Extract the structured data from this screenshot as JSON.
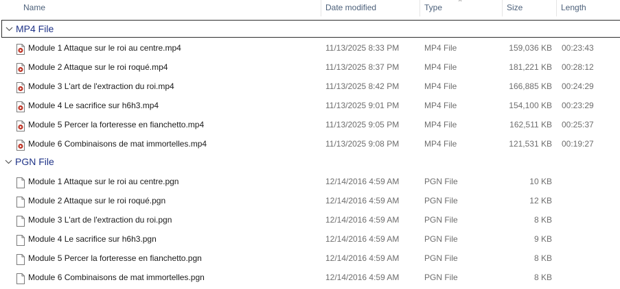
{
  "columns": {
    "name": "Name",
    "date_modified": "Date modified",
    "type": "Type",
    "size": "Size",
    "length": "Length"
  },
  "sort_indicator": "^",
  "groups": [
    {
      "label": "MP4 File",
      "icon": "video-file-icon",
      "files": [
        {
          "name": "Module 1  Attaque sur le roi au centre.mp4",
          "date": "11/13/2025 8:33 PM",
          "type": "MP4 File",
          "size": "159,036 KB",
          "length": "00:23:43"
        },
        {
          "name": "Module 2  Attaque sur le roi roqué.mp4",
          "date": "11/13/2025 8:37 PM",
          "type": "MP4 File",
          "size": "181,221 KB",
          "length": "00:28:12"
        },
        {
          "name": "Module 3  L'art de l'extraction du roi.mp4",
          "date": "11/13/2025 8:42 PM",
          "type": "MP4 File",
          "size": "166,885 KB",
          "length": "00:24:29"
        },
        {
          "name": "Module 4  Le sacrifice sur h6h3.mp4",
          "date": "11/13/2025 9:01 PM",
          "type": "MP4 File",
          "size": "154,100 KB",
          "length": "00:23:29"
        },
        {
          "name": "Module 5  Percer la forteresse en fianchetto.mp4",
          "date": "11/13/2025 9:05 PM",
          "type": "MP4 File",
          "size": "162,511 KB",
          "length": "00:25:37"
        },
        {
          "name": "Module 6  Combinaisons de mat immortelles.mp4",
          "date": "11/13/2025 9:08 PM",
          "type": "MP4 File",
          "size": "121,531 KB",
          "length": "00:19:27"
        }
      ]
    },
    {
      "label": "PGN File",
      "icon": "blank-file-icon",
      "files": [
        {
          "name": "Module 1  Attaque sur le roi au centre.pgn",
          "date": "12/14/2016 4:59 AM",
          "type": "PGN File",
          "size": "10 KB",
          "length": ""
        },
        {
          "name": "Module 2  Attaque sur le roi roqué.pgn",
          "date": "12/14/2016 4:59 AM",
          "type": "PGN File",
          "size": "12 KB",
          "length": ""
        },
        {
          "name": "Module 3  L'art de l'extraction du roi.pgn",
          "date": "12/14/2016 4:59 AM",
          "type": "PGN File",
          "size": "8 KB",
          "length": ""
        },
        {
          "name": "Module 4  Le sacrifice sur h6h3.pgn",
          "date": "12/14/2016 4:59 AM",
          "type": "PGN File",
          "size": "9 KB",
          "length": ""
        },
        {
          "name": "Module 5  Percer la forteresse en fianchetto.pgn",
          "date": "12/14/2016 4:59 AM",
          "type": "PGN File",
          "size": "8 KB",
          "length": ""
        },
        {
          "name": "Module 6  Combinaisons de mat immortelles.pgn",
          "date": "12/14/2016 4:59 AM",
          "type": "PGN File",
          "size": "8 KB",
          "length": ""
        }
      ]
    }
  ],
  "colors": {
    "group_label": "#1e3287",
    "header_text": "#4c607a",
    "secondary_text": "#6d6d6d",
    "video_icon_accent": "#c0392b"
  }
}
